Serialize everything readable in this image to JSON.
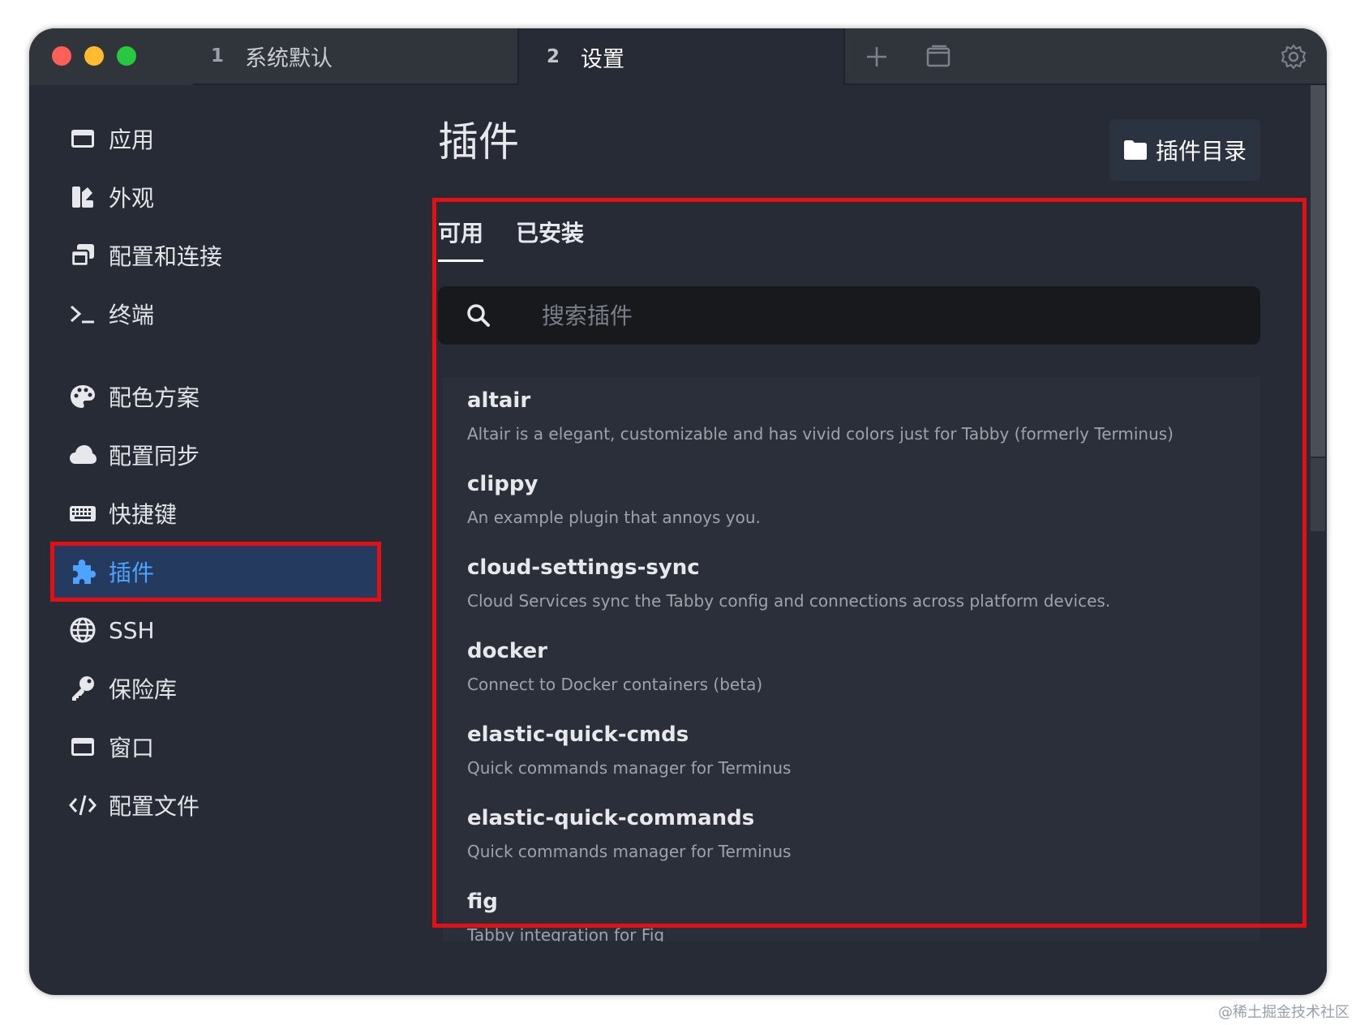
{
  "tabs": [
    {
      "num": "1",
      "label": "系统默认"
    },
    {
      "num": "2",
      "label": "设置"
    }
  ],
  "titlebar_icons": [
    "plus-icon",
    "window-icon",
    "gear-icon"
  ],
  "sidebar": {
    "items": [
      {
        "label": "应用",
        "icon": "window-icon"
      },
      {
        "label": "外观",
        "icon": "palette-swatch-icon"
      },
      {
        "label": "配置和连接",
        "icon": "stacked-windows-icon"
      },
      {
        "label": "终端",
        "icon": "terminal-prompt-icon"
      },
      {
        "label": "配色方案",
        "icon": "palette-icon"
      },
      {
        "label": "配置同步",
        "icon": "cloud-icon"
      },
      {
        "label": "快捷键",
        "icon": "keyboard-icon"
      },
      {
        "label": "插件",
        "icon": "puzzle-icon",
        "active": true
      },
      {
        "label": "SSH",
        "icon": "globe-icon"
      },
      {
        "label": "保险库",
        "icon": "key-icon"
      },
      {
        "label": "窗口",
        "icon": "window-icon"
      },
      {
        "label": "配置文件",
        "icon": "code-icon"
      }
    ]
  },
  "main": {
    "title": "插件",
    "dir_button": "插件目录",
    "tabs": [
      "可用",
      "已安装"
    ],
    "active_tab": "可用",
    "search": {
      "placeholder": "搜索插件",
      "value": ""
    },
    "plugins": [
      {
        "name": "altair",
        "desc": "Altair is a elegant, customizable and has vivid colors just for Tabby (formerly Terminus)"
      },
      {
        "name": "clippy",
        "desc": "An example plugin that annoys you."
      },
      {
        "name": "cloud-settings-sync",
        "desc": "Cloud Services sync the Tabby config and connections across platform devices."
      },
      {
        "name": "docker",
        "desc": "Connect to Docker containers (beta)"
      },
      {
        "name": "elastic-quick-cmds",
        "desc": "Quick commands manager for Terminus"
      },
      {
        "name": "elastic-quick-commands",
        "desc": "Quick commands manager for Terminus"
      },
      {
        "name": "fig",
        "desc": "Tabby integration for Fig"
      }
    ]
  },
  "colors": {
    "background": "#262b35",
    "active_nav": "#243a5e",
    "accent": "#4da3ff",
    "highlight": "#e40f14"
  },
  "watermark": "@稀土掘金技术社区"
}
